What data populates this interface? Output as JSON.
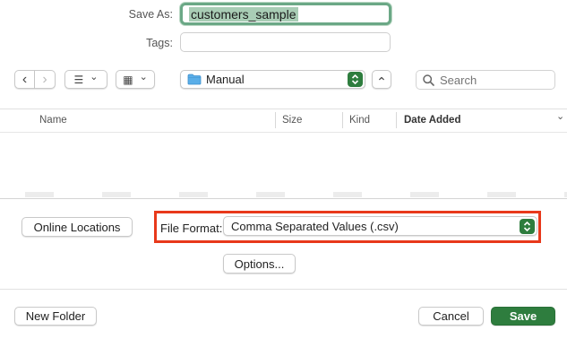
{
  "save_as": {
    "label": "Save As:",
    "value": "customers_sample"
  },
  "tags": {
    "label": "Tags:",
    "value": ""
  },
  "toolbar": {
    "back_glyph": "‹",
    "forward_glyph": "›",
    "list_view_glyph": "☰",
    "gallery_view_glyph": "▦",
    "chevron_glyph": "⌄",
    "location": "Manual",
    "collapse_glyph": "⌃",
    "search_placeholder": "Search"
  },
  "file_list": {
    "columns": [
      "Name",
      "Size",
      "Kind",
      "Date Added"
    ],
    "sort_glyph": "⌄"
  },
  "format": {
    "online_locations": "Online Locations",
    "label": "File Format:",
    "value": "Comma Separated Values (.csv)",
    "options_button": "Options..."
  },
  "footer": {
    "new_folder": "New Folder",
    "cancel": "Cancel",
    "save": "Save"
  },
  "colors": {
    "accent": "#2e7d3e",
    "highlight": "#e8391b"
  }
}
